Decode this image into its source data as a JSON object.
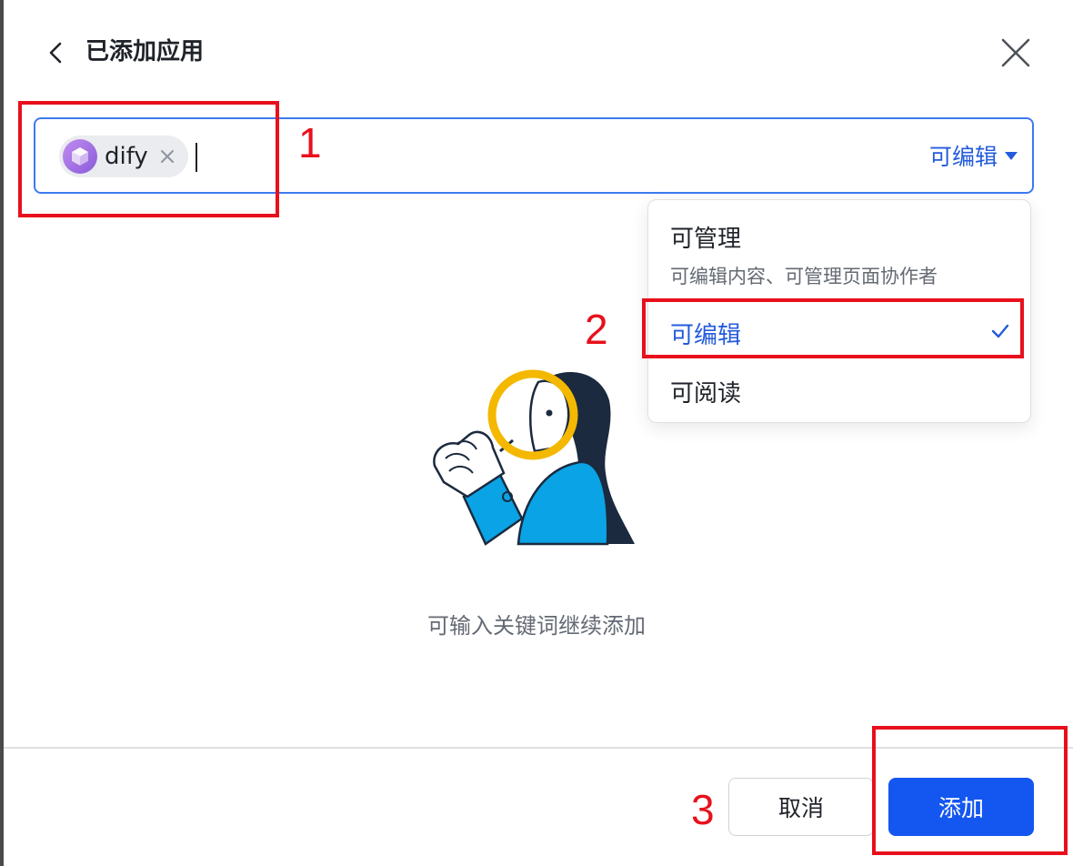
{
  "header": {
    "title": "已添加应用",
    "back_icon": "chevron-left-icon",
    "close_icon": "close-icon"
  },
  "picker": {
    "chip": {
      "label": "dify",
      "avatar_icon": "cube-icon",
      "avatar_color": "#a573e6"
    },
    "permission_selected": "可编辑"
  },
  "dropdown": {
    "items": [
      {
        "title": "可管理",
        "desc": "可编辑内容、可管理页面协作者",
        "selected": false
      },
      {
        "title": "可编辑",
        "desc": "",
        "selected": true
      },
      {
        "title": "可阅读",
        "desc": "",
        "selected": false
      }
    ]
  },
  "empty_state": {
    "text": "可输入关键词继续添加",
    "illustration": "magnifier-person-illustration"
  },
  "footer": {
    "cancel_label": "取消",
    "add_label": "添加"
  },
  "annotations": [
    "1",
    "2",
    "3"
  ],
  "colors": {
    "accent": "#245bdb",
    "primary_button": "#1456f0",
    "annotation": "#e8101c"
  }
}
